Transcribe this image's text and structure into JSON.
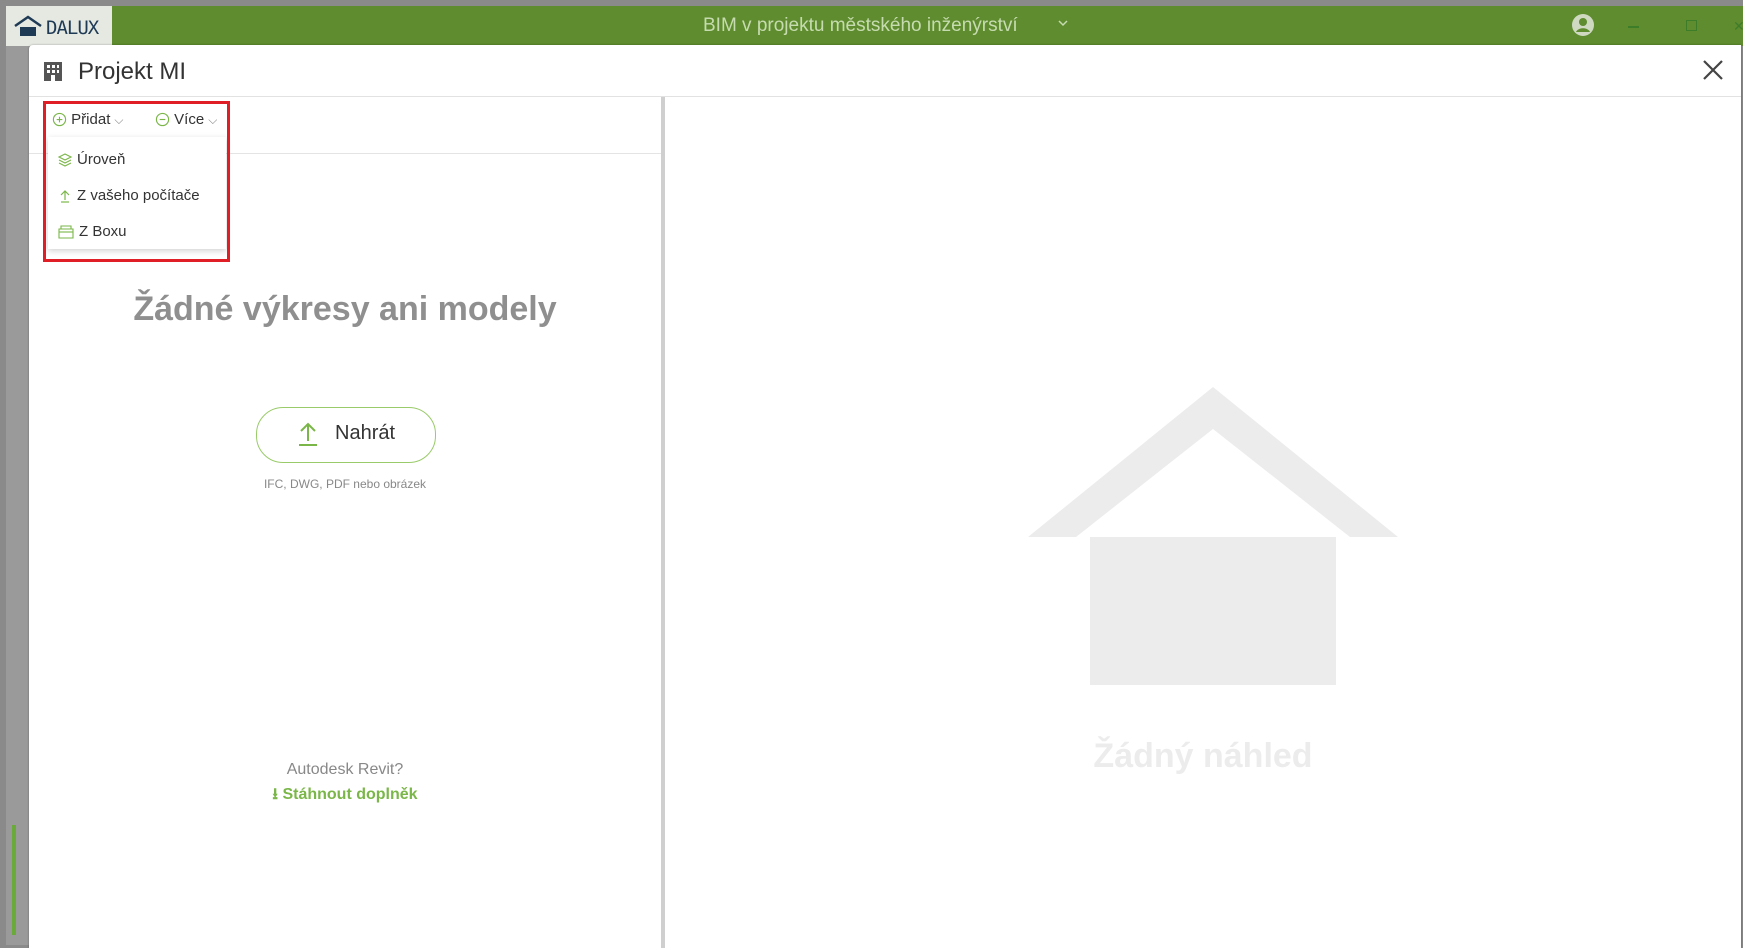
{
  "app": {
    "brand": "DALUX",
    "project_name": "BIM v projektu městského inženýrství"
  },
  "modal": {
    "title": "Projekt MI",
    "toolbar": {
      "add_label": "Přidat",
      "more_label": "Více"
    },
    "add_menu": {
      "items": [
        {
          "label": "Úroveň",
          "icon": "layers-icon"
        },
        {
          "label": "Z vašeho počítače",
          "icon": "upload-icon"
        },
        {
          "label": "Z Boxu",
          "icon": "box-folder-icon"
        }
      ]
    },
    "left_panel": {
      "empty_title": "Žádné výkresy ani modely",
      "upload_label": "Nahrát",
      "upload_hint": "IFC, DWG, PDF nebo obrázek",
      "revit_question": "Autodesk Revit?",
      "revit_link": "⭳ Stáhnout doplněk"
    },
    "right_panel": {
      "empty_preview": "Žádný náhled"
    }
  },
  "colors": {
    "titlebar": "#5f8c2e",
    "accent_green": "#7ab648",
    "highlight_red": "#e01e26"
  }
}
